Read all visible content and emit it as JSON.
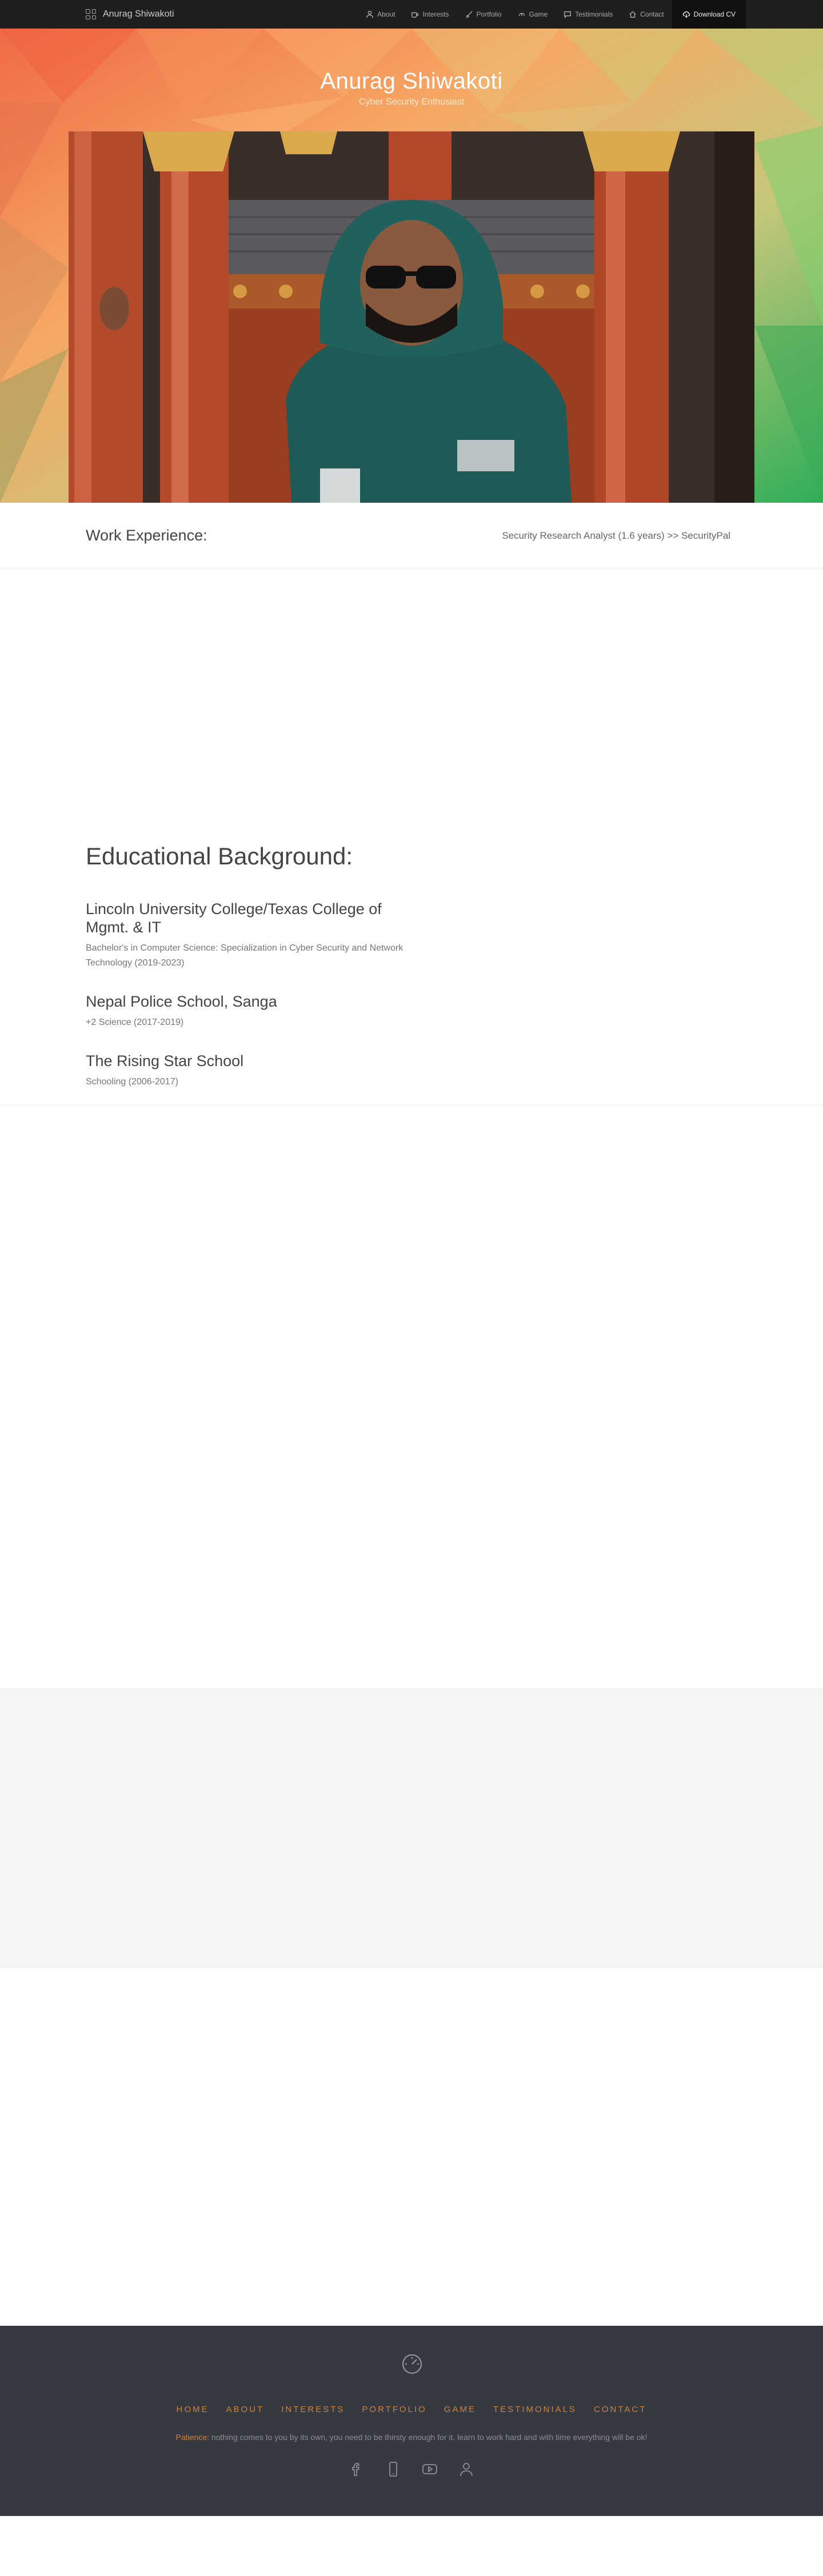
{
  "navbar": {
    "brand": "Anurag Shiwakoti",
    "brand_icon": "grid-icon",
    "items": [
      {
        "label": "About",
        "icon": "user-icon"
      },
      {
        "label": "Interests",
        "icon": "coffee-icon"
      },
      {
        "label": "Portfolio",
        "icon": "brush-icon"
      },
      {
        "label": "Game",
        "icon": "gamepad-icon"
      },
      {
        "label": "Testimonials",
        "icon": "chat-icon"
      },
      {
        "label": "Contact",
        "icon": "home-icon"
      }
    ],
    "download": {
      "label": "Download CV",
      "icon": "cloud-download-icon"
    }
  },
  "hero": {
    "name": "Anurag Shiwakoti",
    "tagline": "Cyber Security Enthusiast"
  },
  "work": {
    "heading": "Work Experience:",
    "role": "Security Research Analyst (1.6 years) >> SecurityPal"
  },
  "education": {
    "heading": "Educational Background:",
    "items": [
      {
        "school": "Lincoln University College/Texas College of Mgmt. & IT",
        "detail": "Bachelor's in Computer Science: Specialization in Cyber Security and Network Technology (2019-2023)"
      },
      {
        "school": "Nepal Police School, Sanga",
        "detail": "+2 Science (2017-2019)"
      },
      {
        "school": "The Rising Star School",
        "detail": "Schooling (2006-2017)"
      }
    ]
  },
  "footer": {
    "logo_icon": "speedometer-icon",
    "nav": [
      "HOME",
      "ABOUT",
      "INTERESTS",
      "PORTFOLIO",
      "GAME",
      "TESTIMONIALS",
      "CONTACT"
    ],
    "quote_key": "Patience:",
    "quote_text": "nothing comes to you by its own, you need to be thirsty enough for it. learn to work hard and with time everything will be ok!",
    "social": [
      "facebook-icon",
      "mobile-icon",
      "youtube-icon",
      "user-icon"
    ]
  },
  "colors": {
    "nav_bg": "#1f1f1f",
    "hero_orange": "#f08a4b",
    "hero_green": "#3cb35a",
    "footer_bg": "#363842",
    "footer_accent": "#c9843c"
  }
}
